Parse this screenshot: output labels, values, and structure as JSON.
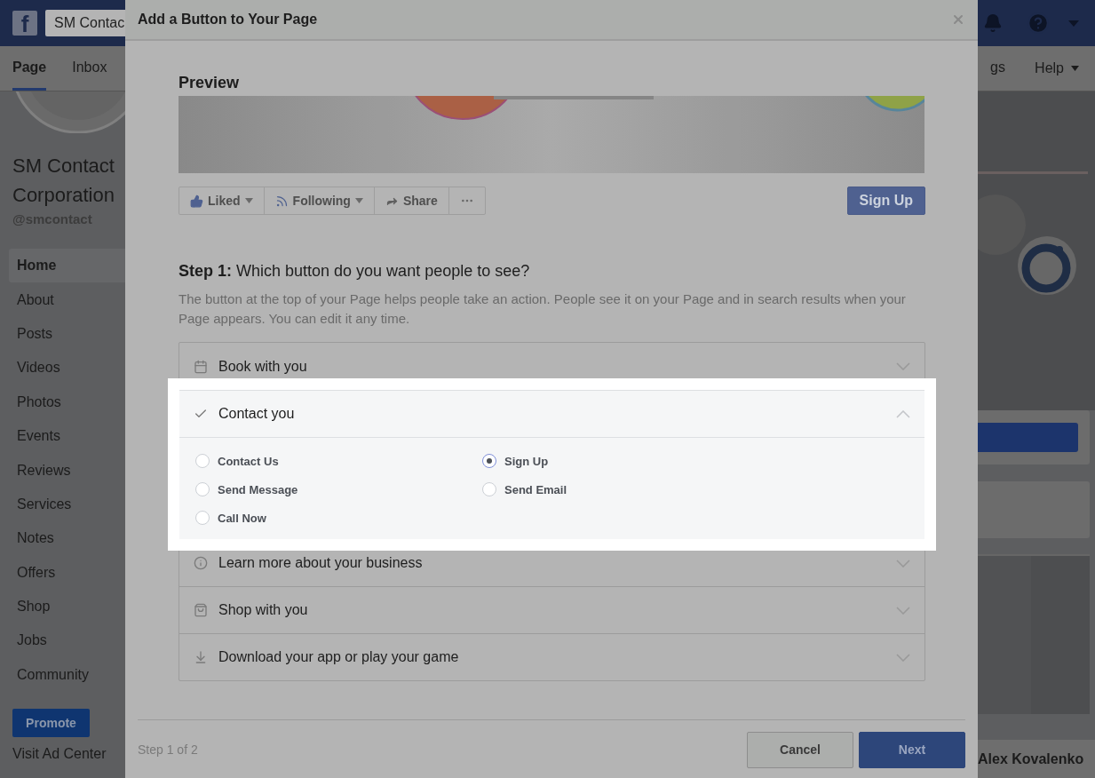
{
  "top_bar": {
    "logo": "f",
    "search_value": "SM Contac"
  },
  "page_tabs": [
    {
      "label": "Page",
      "selected": true
    },
    {
      "label": "Inbox",
      "selected": false
    }
  ],
  "page_tabs_right": [
    {
      "label": "gs"
    },
    {
      "label": "Help"
    }
  ],
  "page": {
    "name": "SM Contact Corporation",
    "handle": "@smcontact"
  },
  "nav": [
    {
      "label": "Home",
      "selected": true
    },
    {
      "label": "About",
      "selected": false
    },
    {
      "label": "Posts",
      "selected": false
    },
    {
      "label": "Videos",
      "selected": false
    },
    {
      "label": "Photos",
      "selected": false
    },
    {
      "label": "Events",
      "selected": false
    },
    {
      "label": "Reviews",
      "selected": false
    },
    {
      "label": "Services",
      "selected": false
    },
    {
      "label": "Notes",
      "selected": false
    },
    {
      "label": "Offers",
      "selected": false
    },
    {
      "label": "Shop",
      "selected": false
    },
    {
      "label": "Jobs",
      "selected": false
    },
    {
      "label": "Community",
      "selected": false
    }
  ],
  "promote": "Promote",
  "ad_center": "Visit Ad Center",
  "user_name": "Alex Kovalenko",
  "dialog": {
    "title": "Add a Button to Your Page",
    "preview_label": "Preview",
    "actions": [
      {
        "label": "Liked",
        "kind": "like"
      },
      {
        "label": "Following",
        "kind": "follow"
      },
      {
        "label": "Share",
        "kind": "share"
      },
      {
        "kind": "more"
      }
    ],
    "preview_button": "Sign Up",
    "step_heading": "**Step 1:** Which button do you want people to see?",
    "description": "The button at the top of your Page helps people take an action. People see it on your Page and in search results when your Page appears. You can edit it any time.",
    "categories": [
      {
        "label": "Book with you",
        "expanded": false
      },
      {
        "label": "Contact you",
        "expanded": true,
        "options": [
          {
            "label": "Contact Us",
            "selected": false
          },
          {
            "label": "Sign Up",
            "selected": true
          },
          {
            "label": "Send Message",
            "selected": false
          },
          {
            "label": "Send Email",
            "selected": false
          },
          {
            "label": "Call Now",
            "selected": false
          }
        ]
      },
      {
        "label": "Learn more about your business",
        "expanded": false
      },
      {
        "label": "Shop with you",
        "expanded": false
      },
      {
        "label": "Download your app or play your game",
        "expanded": false
      }
    ],
    "footer_step": "Step 1 of 2",
    "buttons": [
      {
        "label": "Cancel",
        "kind": "secondary"
      },
      {
        "label": "Next",
        "kind": "primary"
      }
    ]
  }
}
